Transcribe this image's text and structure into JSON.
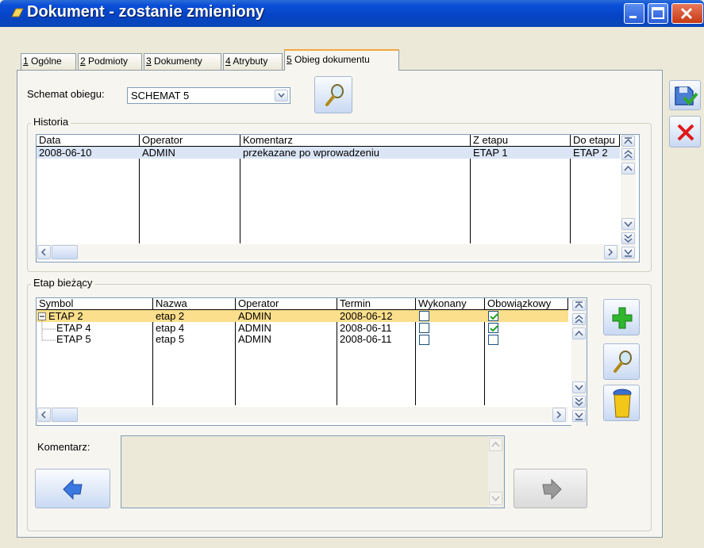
{
  "window": {
    "title": "Dokument - zostanie zmieniony"
  },
  "tabs": [
    {
      "num": "1",
      "label": " Ogólne"
    },
    {
      "num": "2",
      "label": " Podmioty"
    },
    {
      "num": "3",
      "label": " Dokumenty"
    },
    {
      "num": "4",
      "label": " Atrybuty"
    },
    {
      "num": "5",
      "label": " Obieg dokumentu"
    }
  ],
  "schemat": {
    "label": "Schemat obiegu:",
    "value": "SCHEMAT 5"
  },
  "historia": {
    "title": "Historia",
    "columns": [
      "Data",
      "Operator",
      "Komentarz",
      "Z etapu",
      "Do etapu"
    ],
    "rows": [
      {
        "data": "2008-06-10",
        "operator": "ADMIN",
        "komentarz": "przekazane po wprowadzeniu",
        "z_etapu": "ETAP 1",
        "do_etapu": "ETAP 2"
      }
    ]
  },
  "etap": {
    "title": "Etap bieżący",
    "columns": [
      "Symbol",
      "Nazwa",
      "Operator",
      "Termin",
      "Wykonany",
      "Obowiązkowy"
    ],
    "rows": [
      {
        "symbol": "ETAP 2",
        "nazwa": "etap 2",
        "operator": "ADMIN",
        "termin": "2008-06-12",
        "wykonany": false,
        "obowiazkowy": true
      },
      {
        "symbol": "ETAP 4",
        "nazwa": "etap 4",
        "operator": "ADMIN",
        "termin": "2008-06-11",
        "wykonany": false,
        "obowiazkowy": true
      },
      {
        "symbol": "ETAP 5",
        "nazwa": "etap 5",
        "operator": "ADMIN",
        "termin": "2008-06-11",
        "wykonany": false,
        "obowiazkowy": false
      }
    ]
  },
  "komentarz": {
    "label": "Komentarz:",
    "value": ""
  },
  "icons": {
    "title": "document-icon",
    "search": "magnifier-icon",
    "save": "save-icon",
    "cancel": "cancel-icon",
    "add": "plus-icon",
    "delete": "trash-icon",
    "back": "arrow-left-icon",
    "forward": "arrow-right-icon"
  },
  "colors": {
    "selected_row": "#fcdf8c",
    "title_bar": "#0a4fd8",
    "add_green": "#2fb52f",
    "cancel_red": "#e01818"
  }
}
